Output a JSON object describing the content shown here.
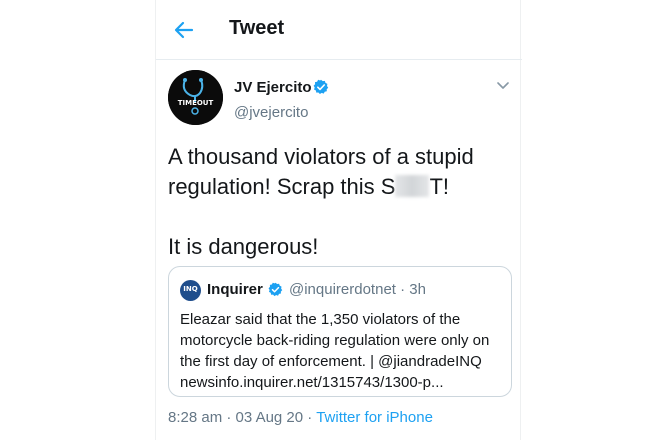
{
  "header": {
    "title": "Tweet"
  },
  "tweet": {
    "author_name": "JV Ejercito",
    "author_handle": "@jvejercito",
    "avatar_text": "TIMEOUT",
    "text_lines": [
      "A thousand violators of a stupid",
      "regulation!  Scrap this S",
      "T!",
      "It is dangerous!"
    ],
    "time": "8:28 am",
    "separator": "·",
    "date": "03 Aug 20",
    "source": "Twitter for iPhone"
  },
  "quoted_tweet": {
    "logo_text": "INQ",
    "name": "Inquirer",
    "handle_time": "@inquirerdotnet · 3h",
    "body_lines": [
      "Eleazar said that the 1,350 violators of the",
      "motorcycle back-riding regulation were only on",
      "the first day of enforcement. | @jiandradeINQ",
      "newsinfo.inquirer.net/1315743/1300-p..."
    ]
  },
  "colors": {
    "accent": "#1da1f2",
    "text": "#14171a",
    "secondary_text": "#657786",
    "border": "#ccd6dd"
  },
  "icons": {
    "back": "arrow-left-icon",
    "verified": "verified-badge-icon",
    "more": "chevron-down-icon"
  }
}
